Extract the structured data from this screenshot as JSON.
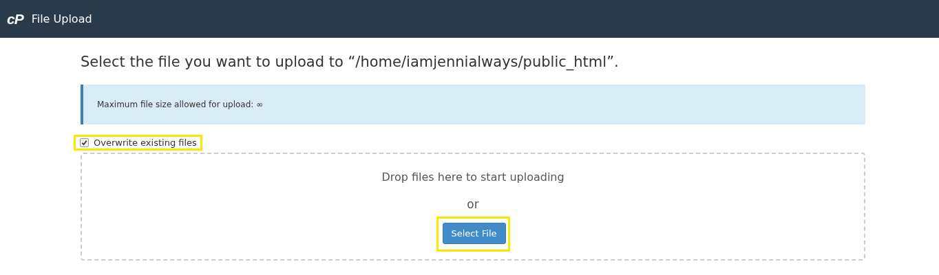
{
  "header": {
    "logo": "cP",
    "title": "File Upload"
  },
  "heading": "Select the file you want to upload to “/home/iamjennialways/public_html”.",
  "alert": "Maximum file size allowed for upload: ∞",
  "overwrite": {
    "label": "Overwrite existing files",
    "checked": true,
    "highlighted": true
  },
  "dropzone": {
    "prompt": "Drop files here to start uploading",
    "separator": "or",
    "button": {
      "label": "Select File",
      "highlighted": true
    }
  }
}
